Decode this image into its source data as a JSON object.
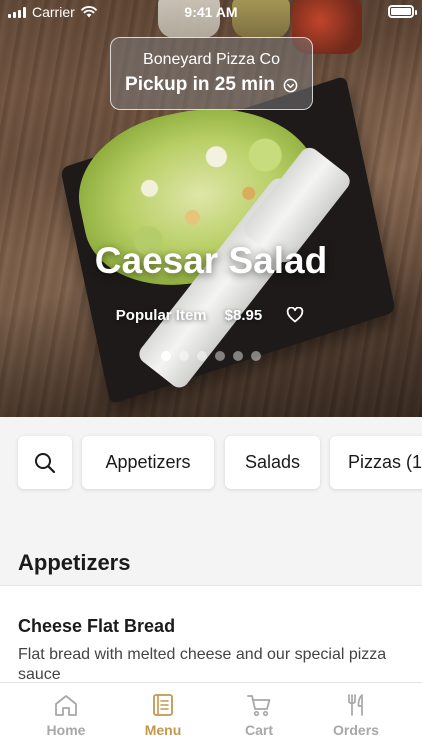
{
  "status_bar": {
    "carrier": "Carrier",
    "time": "9:41 AM",
    "battery_level": 1.0
  },
  "pickup": {
    "store_name": "Boneyard Pizza Co",
    "eta": "Pickup in 25 min",
    "icon": "chevron-circle-down-icon"
  },
  "hero": {
    "title": "Caesar Salad",
    "badge": "Popular Item",
    "price": "$8.95",
    "favorite_icon": "heart-outline-icon",
    "carousel": {
      "count": 6,
      "active_index": 0
    }
  },
  "categories": {
    "search_icon": "search-icon",
    "items": [
      "Appetizers",
      "Salads",
      "Pizzas (1"
    ]
  },
  "section": {
    "title": "Appetizers"
  },
  "menu_items": [
    {
      "name": "Cheese Flat Bread",
      "description": "Flat bread with melted cheese and our special pizza sauce"
    }
  ],
  "tabbar": {
    "tabs": [
      {
        "label": "Home",
        "icon": "home-icon",
        "active": false
      },
      {
        "label": "Menu",
        "icon": "menu-book-icon",
        "active": true
      },
      {
        "label": "Cart",
        "icon": "cart-icon",
        "active": false
      },
      {
        "label": "Orders",
        "icon": "fork-knife-icon",
        "active": false
      }
    ]
  },
  "colors": {
    "accent": "#c4974e",
    "inactive": "#a8a8a8",
    "category_bg": "#f4f4f4"
  }
}
